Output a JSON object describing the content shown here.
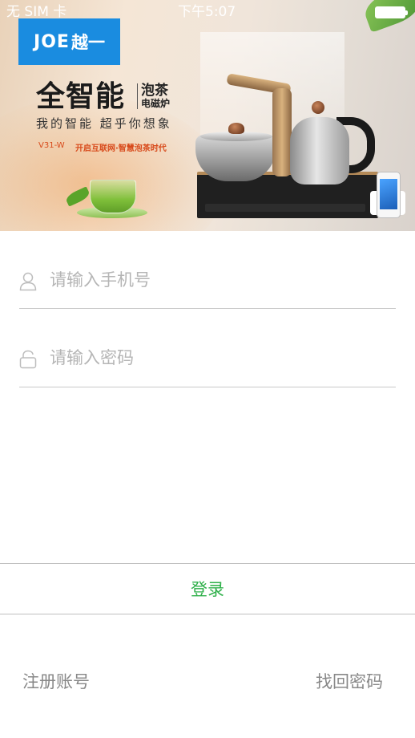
{
  "status_bar": {
    "carrier": "无 SIM 卡",
    "time": "下午5:07"
  },
  "banner": {
    "logo_en": "JOE",
    "logo_cn": "越一",
    "headline": "全智能",
    "headline_side_1": "泡茶",
    "headline_side_2": "电磁炉",
    "slogan": "我的智能  超乎你想象",
    "model": "V31-W",
    "model_tagline": "开启互联网·智慧泡茶时代"
  },
  "form": {
    "phone_placeholder": "请输入手机号",
    "password_placeholder": "请输入密码"
  },
  "actions": {
    "login_label": "登录",
    "register_label": "注册账号",
    "recover_label": "找回密码"
  },
  "colors": {
    "accent_green": "#2fb04a",
    "logo_blue": "#1a8ce0",
    "placeholder_gray": "#b5b5b5",
    "link_gray": "#888888"
  },
  "icons": {
    "phone_field": "user-icon",
    "password_field": "lock-icon"
  }
}
